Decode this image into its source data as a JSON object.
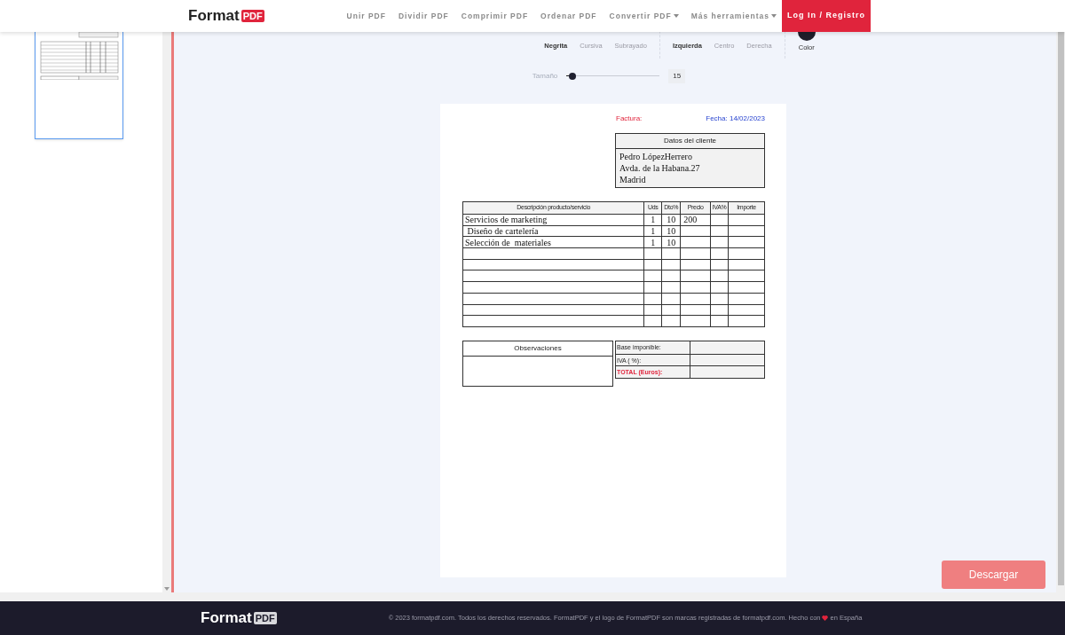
{
  "header": {
    "logo": {
      "word": "Format",
      "badge": "PDF"
    },
    "nav": [
      {
        "label": "Unir PDF",
        "dropdown": false
      },
      {
        "label": "Dividir PDF",
        "dropdown": false
      },
      {
        "label": "Comprimir PDF",
        "dropdown": false
      },
      {
        "label": "Ordenar PDF",
        "dropdown": false
      },
      {
        "label": "Convertir PDF",
        "dropdown": true
      },
      {
        "label": "Más herramientas",
        "dropdown": true
      }
    ],
    "login": "Log In / Registro"
  },
  "sidebar": {
    "thumbnail": {
      "selected": true
    }
  },
  "toolbar": {
    "style_buttons": [
      {
        "label": "Negrita",
        "selected": true
      },
      {
        "label": "Cursiva",
        "selected": false
      },
      {
        "label": "Subrayado",
        "selected": false
      }
    ],
    "align_buttons": [
      {
        "label": "Izquierda",
        "selected": true
      },
      {
        "label": "Centro",
        "selected": false
      },
      {
        "label": "Derecha",
        "selected": false
      }
    ],
    "color": {
      "label": "Color",
      "color": "#1e1e2a"
    }
  },
  "size": {
    "label": "Tamaño",
    "level": 0.06,
    "value": "15"
  },
  "document": {
    "invoice_label": "Factura:",
    "date": "Fecha: 14/02/2023",
    "client": {
      "title": "Datos del cliente",
      "lines": [
        "Pedro LópezHerrero",
        "Avda. de la Habana.27",
        "Madrid"
      ]
    },
    "table": {
      "columns": [
        "Descripción producto/servicio",
        "Uds",
        "Dto%",
        "Precio",
        "IVA%",
        "Importe"
      ],
      "rows": [
        {
          "description": "Servicios de marketing",
          "uds": "1",
          "dto": "10",
          "precio": "200"
        },
        {
          "description": " Diseño de cartelería",
          "uds": "1",
          "dto": "10"
        },
        {
          "description": "Selección de  materiales",
          "uds": "1",
          "dto": "10"
        },
        {},
        {},
        {},
        {},
        {},
        {},
        {}
      ]
    },
    "observations": "Observaciones",
    "summary": [
      {
        "label": "Base imponible:",
        "kind": "plain"
      },
      {
        "label": "IVA ( %):",
        "kind": "plain"
      },
      {
        "label": "TOTAL (Euros):",
        "kind": "total"
      }
    ]
  },
  "download": "Descargar",
  "footer": {
    "logo": {
      "word": "Format",
      "badge": "PDF"
    },
    "text": "© 2023 formatpdf.com. Todos los derechos reservados. FormatPDF y el logo de FormatPDF son marcas registradas de formatpdf.com. Hecho con",
    "after": "en España"
  }
}
